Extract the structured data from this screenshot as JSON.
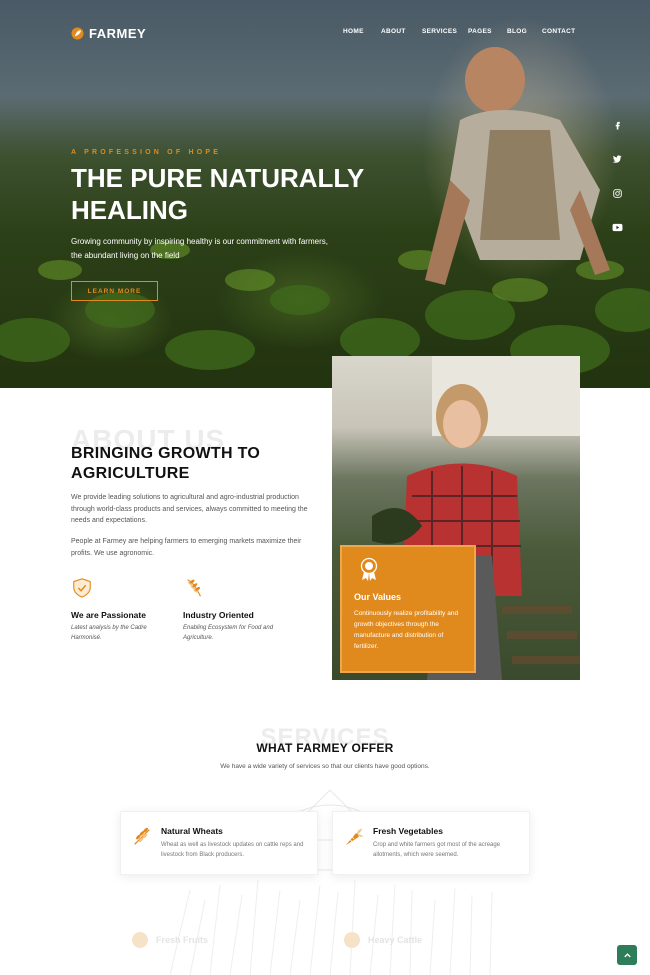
{
  "brand": {
    "name": "FARMEY",
    "accent": "#e08a1e"
  },
  "nav": {
    "items": [
      {
        "label": "HOME"
      },
      {
        "label": "ABOUT"
      },
      {
        "label": "SERVICES"
      },
      {
        "label": "PAGES"
      },
      {
        "label": "BLOG"
      },
      {
        "label": "CONTACT"
      }
    ]
  },
  "social": [
    "facebook-icon",
    "twitter-icon",
    "instagram-icon",
    "youtube-icon"
  ],
  "hero": {
    "kicker": "A PROFESSION OF HOPE",
    "title": "THE PURE NATURALLY HEALING",
    "description": "Growing community by inspiring healthy is our commitment with farmers, the abundant living on the field",
    "button": "LEARN MORE"
  },
  "about": {
    "bg_word": "ABOUT US",
    "title": "BRINGING GROWTH TO AGRICULTURE",
    "paragraph1": "We provide leading solutions to agricultural and agro-industrial production through world-class products and services, always committed to meeting the needs and expectations.",
    "paragraph2": "People at Farmey are helping farmers to emerging markets maximize their profits. We use agronomic.",
    "features": [
      {
        "title": "We are Passionate",
        "desc": "Latest analysis by the Cadre Harmonisé."
      },
      {
        "title": "Industry Oriented",
        "desc": "Enabling Ecosystem for Food and Agriculture."
      }
    ],
    "values_card": {
      "title": "Our Values",
      "desc": "Continuously realize profitability and growth objectives through the manufacture and distribution of fertilizer."
    }
  },
  "services": {
    "bg_word": "SERVICES",
    "title": "WHAT FARMEY OFFER",
    "subtitle": "We have a wide variety of services so that our clients have good options.",
    "cards": [
      {
        "title": "Natural Wheats",
        "desc": "Wheat as well as livestock updates on cattle reps and livestock from Black producers."
      },
      {
        "title": "Fresh Vegetables",
        "desc": "Crop and white farmers got most of the acreage allotments, which were seemed."
      }
    ],
    "faded": [
      {
        "title": "Fresh Fruits"
      },
      {
        "title": "Heavy Cattle"
      }
    ]
  }
}
